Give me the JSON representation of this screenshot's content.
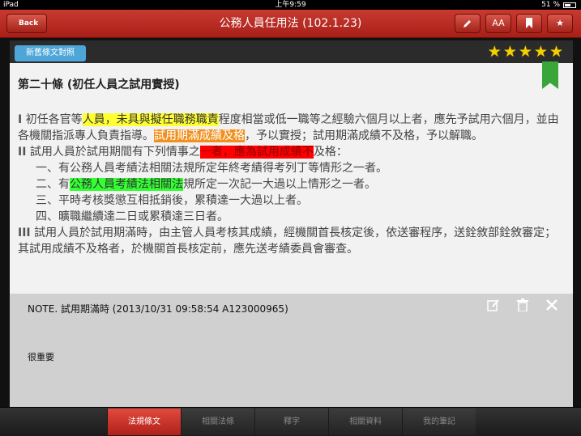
{
  "status_bar": {
    "device": "iPad",
    "time": "上午9:59",
    "battery": "51 %"
  },
  "navbar": {
    "back_label": "Back",
    "title": "公務人員任用法 (102.1.23)",
    "icons": [
      "pencil-icon",
      "font-size-icon",
      "bookmark-icon",
      "star-icon"
    ],
    "font_label": "AA"
  },
  "content": {
    "compare_button": "新舊條文對照",
    "rating": 5,
    "article_title": "第二十條 (初任人員之試用實授)",
    "p1": {
      "num": "I",
      "t1": " 初任各官等",
      "h1": "人員，未具與擬任職務職責",
      "t2": "程度相當或低一職等之經驗六個月以上者，應先予試用六個月，並由各機關指派專人負責指導。",
      "h2": "試用期滿成績及格",
      "t3": "，予以實授；試用期滿成績不及格，予以解職。"
    },
    "p2": {
      "num": "II",
      "t1": " 試用人員於試用期間有下列情事之",
      "h1": "一者，應為試用成績不",
      "t2": "及格："
    },
    "item1": "一、有公務人員考績法相關法規所定年終考績得考列丁等情形之一者。",
    "item2": {
      "t1": "二、有",
      "h1": "公務人員考績法相關法",
      "t2": "規所定一次記一大過以上情形之一者。"
    },
    "item3": "三、平時考核獎懲互相抵銷後，累積達一大過以上者。",
    "item4": "四、曠職繼續達二日或累積達三日者。",
    "p3": {
      "num": "III",
      "t1": " 試用人員於試用期滿時，由主管人員考核其成績，經機關首長核定後，依送審程序，送銓敘部銓敘審定；其試用成績不及格者，於機關首長核定前，應先送考績委員會審查。"
    }
  },
  "note": {
    "header": "NOTE. 試用期滿時 (2013/10/31 09:58:54  A123000965)",
    "body": "很重要",
    "icons": [
      "edit-icon",
      "trash-icon",
      "close-icon"
    ]
  },
  "tabs": [
    "法規條文",
    "相關法條",
    "釋字",
    "相關資料",
    "我的筆記"
  ],
  "colors": {
    "nav_red": "#b82a22",
    "highlight_yellow": "#ffff33",
    "highlight_orange": "#f1901f",
    "highlight_red": "#ff0000",
    "highlight_green": "#33ff33",
    "star": "#f4d000",
    "compare_button": "#4ea6d8"
  }
}
